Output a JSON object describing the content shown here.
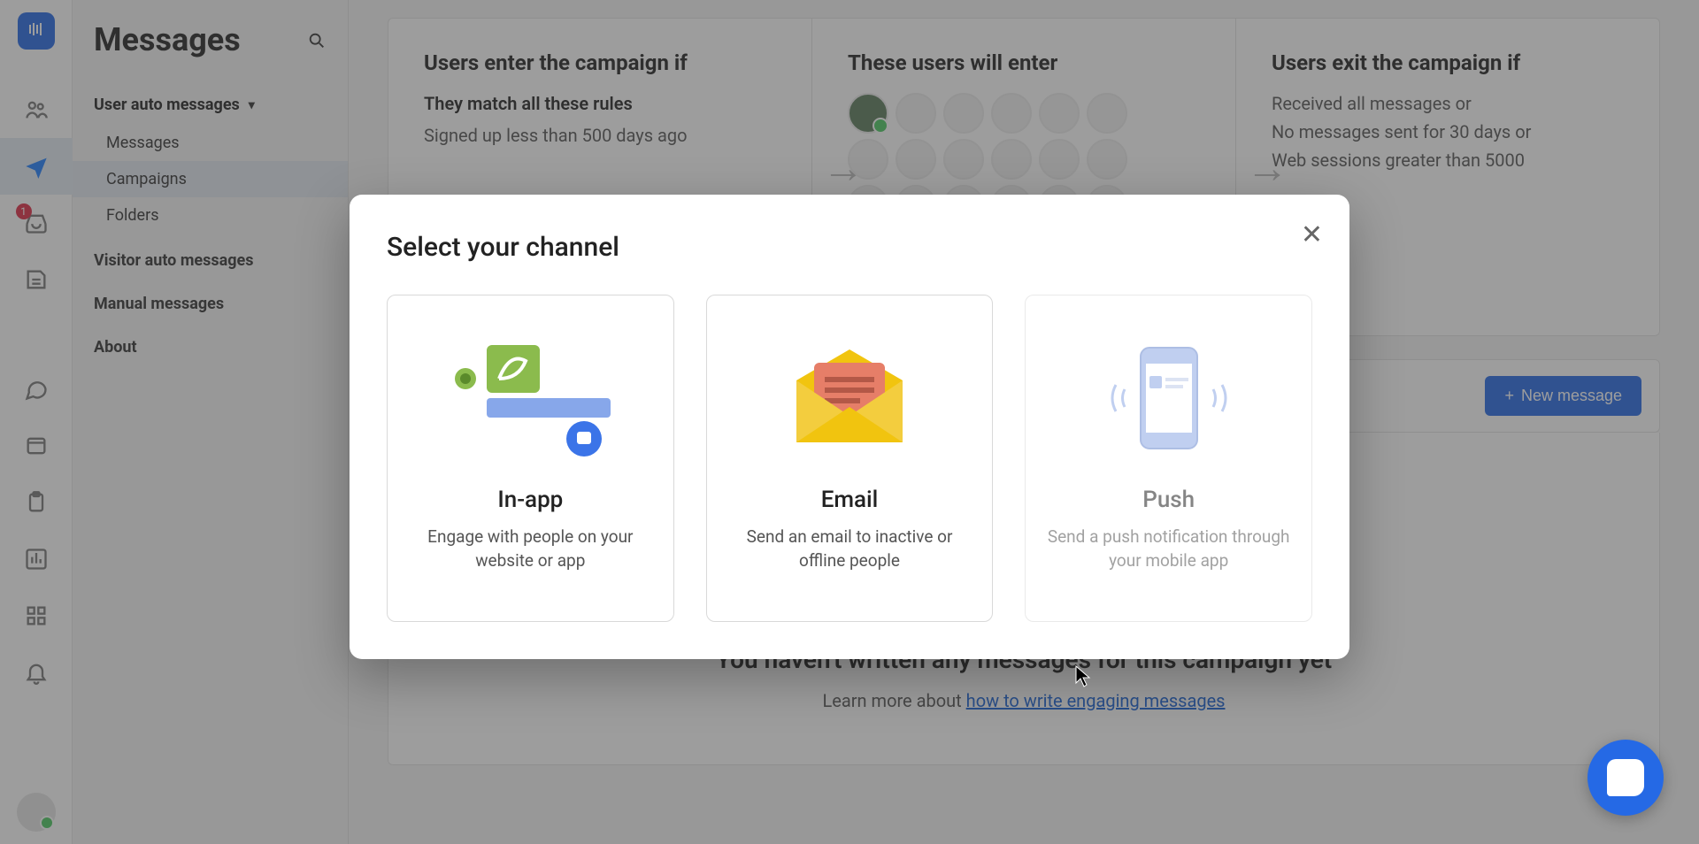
{
  "page_title": "Messages",
  "rail": {
    "badge": "1"
  },
  "sidebar": {
    "user_auto": "User auto messages",
    "messages": "Messages",
    "campaigns": "Campaigns",
    "folders": "Folders",
    "visitor_auto": "Visitor auto messages",
    "manual": "Manual messages",
    "about": "About"
  },
  "columns": {
    "enter": {
      "title": "Users enter the campaign if",
      "subtitle": "They match all these rules",
      "rule": "Signed up less than 500 days ago"
    },
    "users": {
      "title": "These users will enter"
    },
    "exit": {
      "title": "Users exit the campaign if",
      "line1": "Received all messages or",
      "line2": "No messages sent for 30 days or",
      "line3": "Web sessions greater than 5000"
    }
  },
  "new_message_button": "New message",
  "empty": {
    "heading": "You haven't written any messages for this campaign yet",
    "learn_prefix": "Learn more about ",
    "learn_link": "how to write engaging messages"
  },
  "modal": {
    "title": "Select your channel",
    "inapp": {
      "title": "In-app",
      "desc": "Engage with people on your website or app"
    },
    "email": {
      "title": "Email",
      "desc": "Send an email to inactive or offline people"
    },
    "push": {
      "title": "Push",
      "desc": "Send a push notification through your mobile app"
    }
  }
}
